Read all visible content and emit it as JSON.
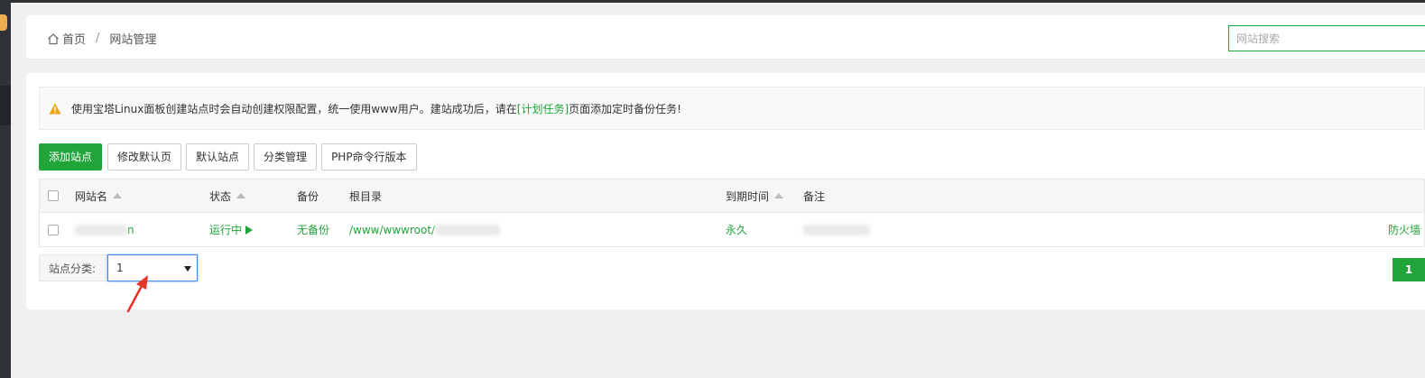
{
  "breadcrumb": {
    "home": "首页",
    "separator": "/",
    "current": "网站管理"
  },
  "search": {
    "placeholder": "网站搜索"
  },
  "alert": {
    "text_before": "使用宝塔Linux面板创建站点时会自动创建权限配置，统一使用www用户。建站成功后，请在",
    "link_text": "[计划任务]",
    "text_after": "页面添加定时备份任务!"
  },
  "toolbar": {
    "add_site": "添加站点",
    "edit_default_page": "修改默认页",
    "default_site": "默认站点",
    "category_manage": "分类管理",
    "php_cli_version": "PHP命令行版本"
  },
  "table": {
    "headers": {
      "site_name": "网站名",
      "status": "状态",
      "backup": "备份",
      "root_dir": "根目录",
      "expire": "到期时间",
      "note": "备注"
    },
    "rows": [
      {
        "site_name_suffix": "n",
        "status": "运行中",
        "backup": "无备份",
        "root_dir": "/www/wwwroot/",
        "expire": "永久",
        "action": "防火墙"
      }
    ]
  },
  "footer": {
    "category_label": "站点分类:",
    "category_value": "1",
    "page": "1"
  },
  "colors": {
    "accent": "#20a53a",
    "sidebar": "#2f3338",
    "focus": "#3a8ee6",
    "annotation": "#e8332a"
  }
}
